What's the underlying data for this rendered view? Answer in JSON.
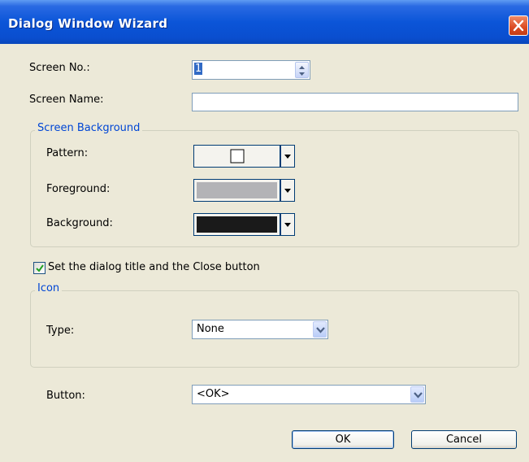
{
  "window": {
    "title": "Dialog Window Wizard"
  },
  "screen_no": {
    "label": "Screen No.:",
    "value": "1"
  },
  "screen_name": {
    "label": "Screen Name:",
    "value": ""
  },
  "screen_background": {
    "title": "Screen Background",
    "pattern": {
      "label": "Pattern:",
      "swatch": "empty-square"
    },
    "foreground": {
      "label": "Foreground:",
      "color": "#b3b3b6"
    },
    "background": {
      "label": "Background:",
      "color": "#1a1a1a"
    }
  },
  "dialog_title_checkbox": {
    "label": "Set the dialog title and the Close button",
    "checked": true
  },
  "icon_group": {
    "title": "Icon",
    "type": {
      "label": "Type:",
      "value": "None"
    }
  },
  "button_field": {
    "label": "Button:",
    "value": "<OK>"
  },
  "actions": {
    "ok": "OK",
    "cancel": "Cancel"
  },
  "colors": {
    "title_bar": "#0b55d8",
    "group_title": "#0046d5",
    "face": "#ece9d8"
  }
}
